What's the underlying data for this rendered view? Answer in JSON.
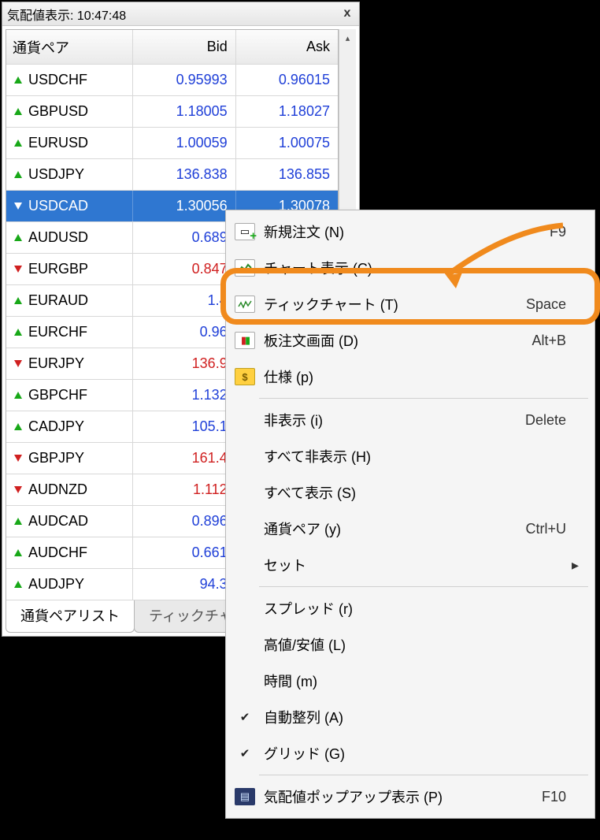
{
  "panel": {
    "title": "気配値表示: 10:47:48",
    "close_icon": "x",
    "headers": {
      "symbol": "通貨ペア",
      "bid": "Bid",
      "ask": "Ask"
    },
    "rows": [
      {
        "dir": "up",
        "sym": "USDCHF",
        "bid": "0.95993",
        "ask": "0.96015",
        "cls": "price-up"
      },
      {
        "dir": "up",
        "sym": "GBPUSD",
        "bid": "1.18005",
        "ask": "1.18027",
        "cls": "price-up"
      },
      {
        "dir": "up",
        "sym": "EURUSD",
        "bid": "1.00059",
        "ask": "1.00075",
        "cls": "price-up"
      },
      {
        "dir": "up",
        "sym": "USDJPY",
        "bid": "136.838",
        "ask": "136.855",
        "cls": "price-up"
      },
      {
        "dir": "dn",
        "sym": "USDCAD",
        "bid": "1.30056",
        "ask": "1.30078",
        "cls": "price-up",
        "sel": true
      },
      {
        "dir": "up",
        "sym": "AUDUSD",
        "bid": "0.689",
        "ask": "",
        "cls": "price-up"
      },
      {
        "dir": "dn",
        "sym": "EURGBP",
        "bid": "0.847",
        "ask": "",
        "cls": "price-dn"
      },
      {
        "dir": "up",
        "sym": "EURAUD",
        "bid": "1.4",
        "ask": "",
        "cls": "price-up"
      },
      {
        "dir": "up",
        "sym": "EURCHF",
        "bid": "0.96",
        "ask": "",
        "cls": "price-up"
      },
      {
        "dir": "dn",
        "sym": "EURJPY",
        "bid": "136.9",
        "ask": "",
        "cls": "price-dn"
      },
      {
        "dir": "up",
        "sym": "GBPCHF",
        "bid": "1.132",
        "ask": "",
        "cls": "price-up"
      },
      {
        "dir": "up",
        "sym": "CADJPY",
        "bid": "105.1",
        "ask": "",
        "cls": "price-up"
      },
      {
        "dir": "dn",
        "sym": "GBPJPY",
        "bid": "161.4",
        "ask": "",
        "cls": "price-dn"
      },
      {
        "dir": "dn",
        "sym": "AUDNZD",
        "bid": "1.112",
        "ask": "",
        "cls": "price-dn"
      },
      {
        "dir": "up",
        "sym": "AUDCAD",
        "bid": "0.896",
        "ask": "",
        "cls": "price-up"
      },
      {
        "dir": "up",
        "sym": "AUDCHF",
        "bid": "0.661",
        "ask": "",
        "cls": "price-up"
      },
      {
        "dir": "up",
        "sym": "AUDJPY",
        "bid": "94.3",
        "ask": "",
        "cls": "price-up"
      }
    ],
    "tabs": {
      "list": "通貨ペアリスト",
      "tick": "ティックチャート"
    }
  },
  "menu": {
    "items": [
      {
        "icon": "doc-plus",
        "label": "新規注文 (N)",
        "shortcut": "F9"
      },
      {
        "icon": "chart",
        "label": "チャート表示 (C)",
        "shortcut": ""
      },
      {
        "icon": "tick",
        "label": "ティックチャート (T)",
        "shortcut": "Space"
      },
      {
        "icon": "depth",
        "label": "板注文画面 (D)",
        "shortcut": "Alt+B"
      },
      {
        "icon": "dollar",
        "label": "仕様 (p)",
        "shortcut": ""
      },
      {
        "sep": true
      },
      {
        "icon": "",
        "label": "非表示 (i)",
        "shortcut": "Delete"
      },
      {
        "icon": "",
        "label": "すべて非表示 (H)",
        "shortcut": ""
      },
      {
        "icon": "",
        "label": "すべて表示 (S)",
        "shortcut": ""
      },
      {
        "icon": "",
        "label": "通貨ペア (y)",
        "shortcut": "Ctrl+U"
      },
      {
        "icon": "",
        "label": "セット",
        "shortcut": "",
        "submenu": true
      },
      {
        "sep": true
      },
      {
        "icon": "",
        "label": "スプレッド (r)",
        "shortcut": ""
      },
      {
        "icon": "",
        "label": "高値/安値 (L)",
        "shortcut": ""
      },
      {
        "icon": "",
        "label": "時間 (m)",
        "shortcut": ""
      },
      {
        "icon": "check",
        "label": "自動整列 (A)",
        "shortcut": ""
      },
      {
        "icon": "check",
        "label": "グリッド (G)",
        "shortcut": ""
      },
      {
        "sep": true
      },
      {
        "icon": "popup",
        "label": "気配値ポップアップ表示 (P)",
        "shortcut": "F10"
      }
    ]
  }
}
